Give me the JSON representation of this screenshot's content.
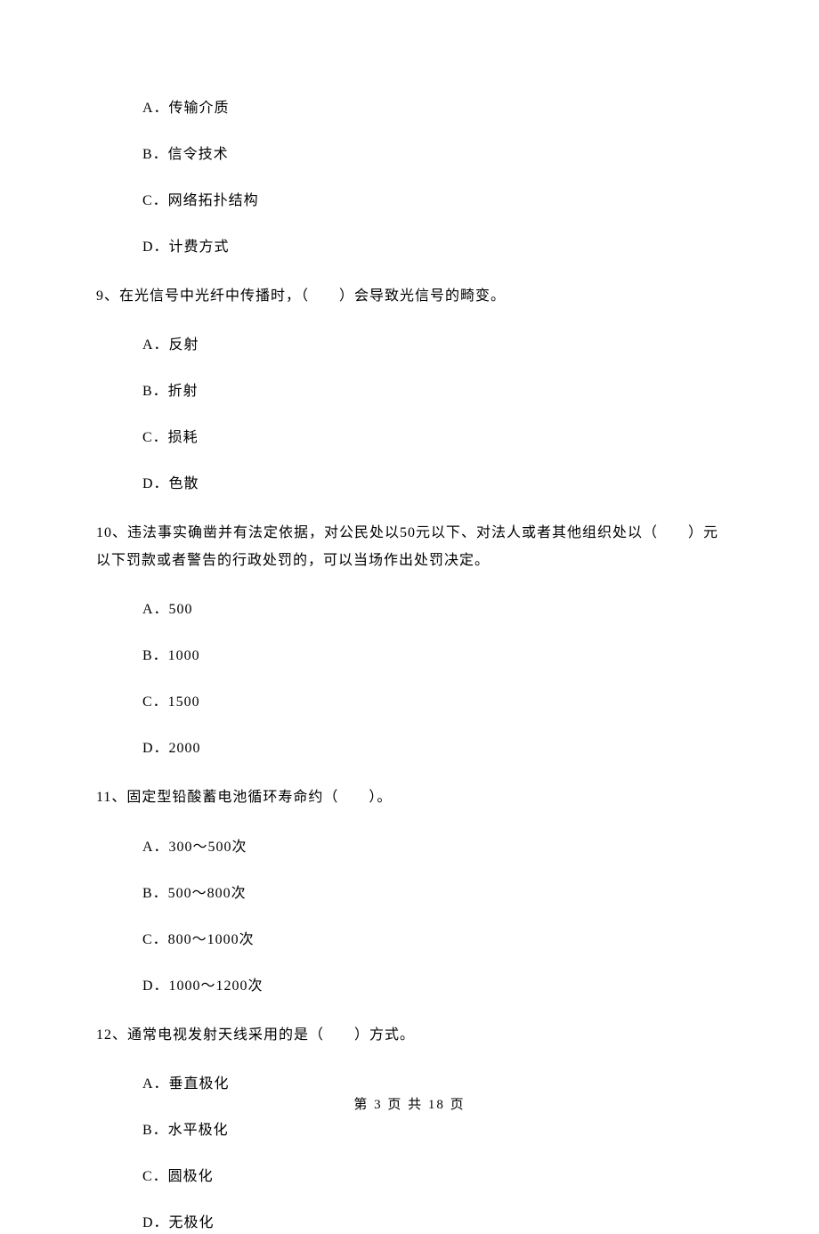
{
  "options_top": {
    "a": "A．传输介质",
    "b": "B．信令技术",
    "c": "C．网络拓扑结构",
    "d": "D．计费方式"
  },
  "q9": {
    "text": "9、在光信号中光纤中传播时，（　　）会导致光信号的畸变。",
    "a": "A．反射",
    "b": "B．折射",
    "c": "C．损耗",
    "d": "D．色散"
  },
  "q10": {
    "text": "10、违法事实确凿并有法定依据，对公民处以50元以下、对法人或者其他组织处以（　　）元以下罚款或者警告的行政处罚的，可以当场作出处罚决定。",
    "a": "A．500",
    "b": "B．1000",
    "c": "C．1500",
    "d": "D．2000"
  },
  "q11": {
    "text": "11、固定型铅酸蓄电池循环寿命约（　　）。",
    "a": "A．300～500次",
    "b": "B．500～800次",
    "c": "C．800～1000次",
    "d": "D．1000～1200次"
  },
  "q12": {
    "text": "12、通常电视发射天线采用的是（　　）方式。",
    "a": "A．垂直极化",
    "b": "B．水平极化",
    "c": "C．圆极化",
    "d": "D．无极化"
  },
  "footer": "第 3 页 共 18 页"
}
